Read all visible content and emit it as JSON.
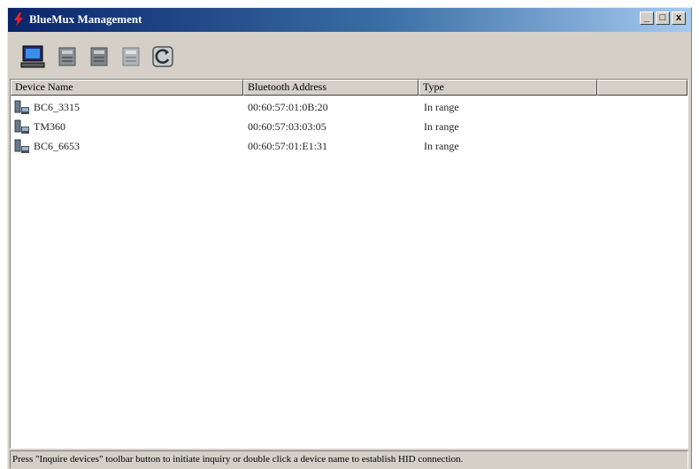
{
  "window": {
    "title": "BlueMux Management",
    "minimize_label": "_",
    "maximize_label": "□",
    "close_label": "x"
  },
  "toolbar": {
    "buttons": [
      {
        "icon": "computer-icon"
      },
      {
        "icon": "device-icon"
      },
      {
        "icon": "device-icon"
      },
      {
        "icon": "device-icon"
      },
      {
        "icon": "refresh-icon"
      }
    ]
  },
  "list": {
    "columns": [
      "Device Name",
      "Bluetooth Address",
      "Type",
      ""
    ],
    "rows": [
      {
        "name": "BC6_3315",
        "address": "00:60:57:01:0B:20",
        "type": "In range"
      },
      {
        "name": "TM360",
        "address": "00:60:57:03:03:05",
        "type": "In range"
      },
      {
        "name": "BC6_6653",
        "address": "00:60:57:01:E1:31",
        "type": "In range"
      }
    ]
  },
  "statusbar": {
    "text": "Press \"Inquire devices\" toolbar button to initiate inquiry or double click a device name to establish HID connection."
  }
}
